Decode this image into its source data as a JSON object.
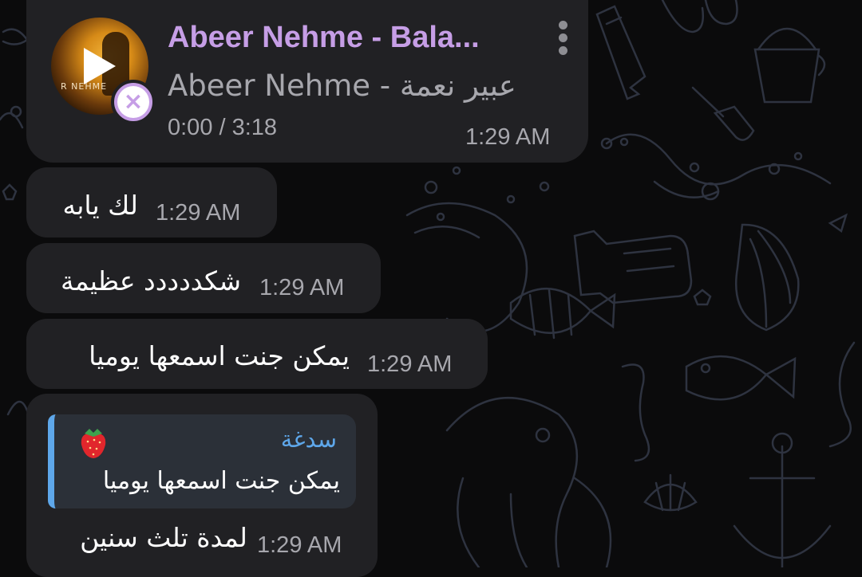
{
  "audio_message": {
    "title": "Abeer Nehme - Bala...",
    "artist_latin": "Abeer Nehme - ",
    "artist_arabic": "عبير نعمة",
    "duration": "0:00 / 3:18",
    "time": "1:29 AM",
    "cover_label": "R NEHME"
  },
  "messages": [
    {
      "text": "لك يابه",
      "time": "1:29 AM"
    },
    {
      "text": "شكددددد عظيمة",
      "time": "1:29 AM"
    },
    {
      "text": "يمكن جنت اسمعها يوميا",
      "time": "1:29 AM"
    }
  ],
  "reply_message": {
    "quoted_name": "سدغة",
    "quoted_text": "يمكن جنت اسمعها يوميا",
    "text": "لمدة تلث سنين",
    "time": "1:29 AM"
  },
  "colors": {
    "background": "#0b0b0c",
    "bubble": "#212124",
    "accent_purple": "#c69ee6",
    "accent_blue": "#5ea7ea",
    "secondary_text": "#a7a7ad"
  },
  "icons": {
    "play": "play-icon",
    "cancel": "cancel-download-icon",
    "menu": "more-vertical-icon",
    "emoji": "strawberry-emoji"
  }
}
